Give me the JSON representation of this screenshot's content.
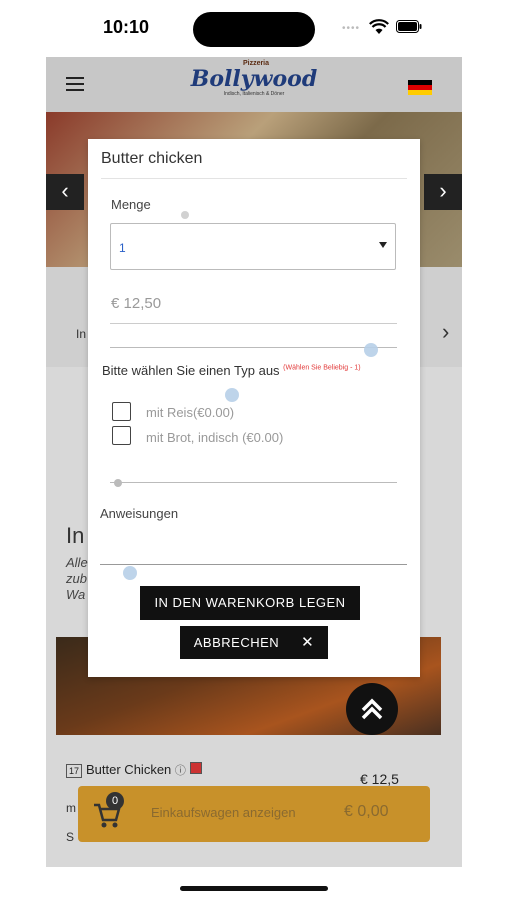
{
  "status_bar": {
    "time": "10:10"
  },
  "header": {
    "logo_small": "Pizzeria",
    "logo_main": "Bollywood",
    "logo_sub": "Indisch, Italienisch & Döner",
    "language_flag": "german-flag"
  },
  "carousel": {
    "prev": "‹",
    "next": "›"
  },
  "category_strip": {
    "partial_label": "In"
  },
  "menu_section": {
    "title_partial": "In",
    "desc_partial": "Alle\nzub\nWa"
  },
  "menu_item": {
    "number": "17",
    "name": "Butter Chicken",
    "price_partial": "€ 12,5",
    "letter_m": "m",
    "letter_s": "S"
  },
  "cart": {
    "badge_count": "0",
    "label": "Einkaufswagen anzeigen",
    "total": "€ 0,00"
  },
  "modal": {
    "title": "Butter chicken",
    "quantity_label": "Menge",
    "quantity_value": "1",
    "price": "€ 12,50",
    "type_label": "Bitte wählen Sie einen Typ aus",
    "type_note": "(Wählen Sie Beliebig - 1)",
    "options": [
      {
        "label": "mit Reis(€0.00)",
        "checked": false
      },
      {
        "label": "mit Brot, indisch (€0.00)",
        "checked": false
      }
    ],
    "instructions_label": "Anweisungen",
    "add_button": "IN DEN WARENKORB LEGEN",
    "cancel_button": "ABBRECHEN",
    "cancel_icon": "✕"
  },
  "fab_icon": "scroll-top-icon"
}
